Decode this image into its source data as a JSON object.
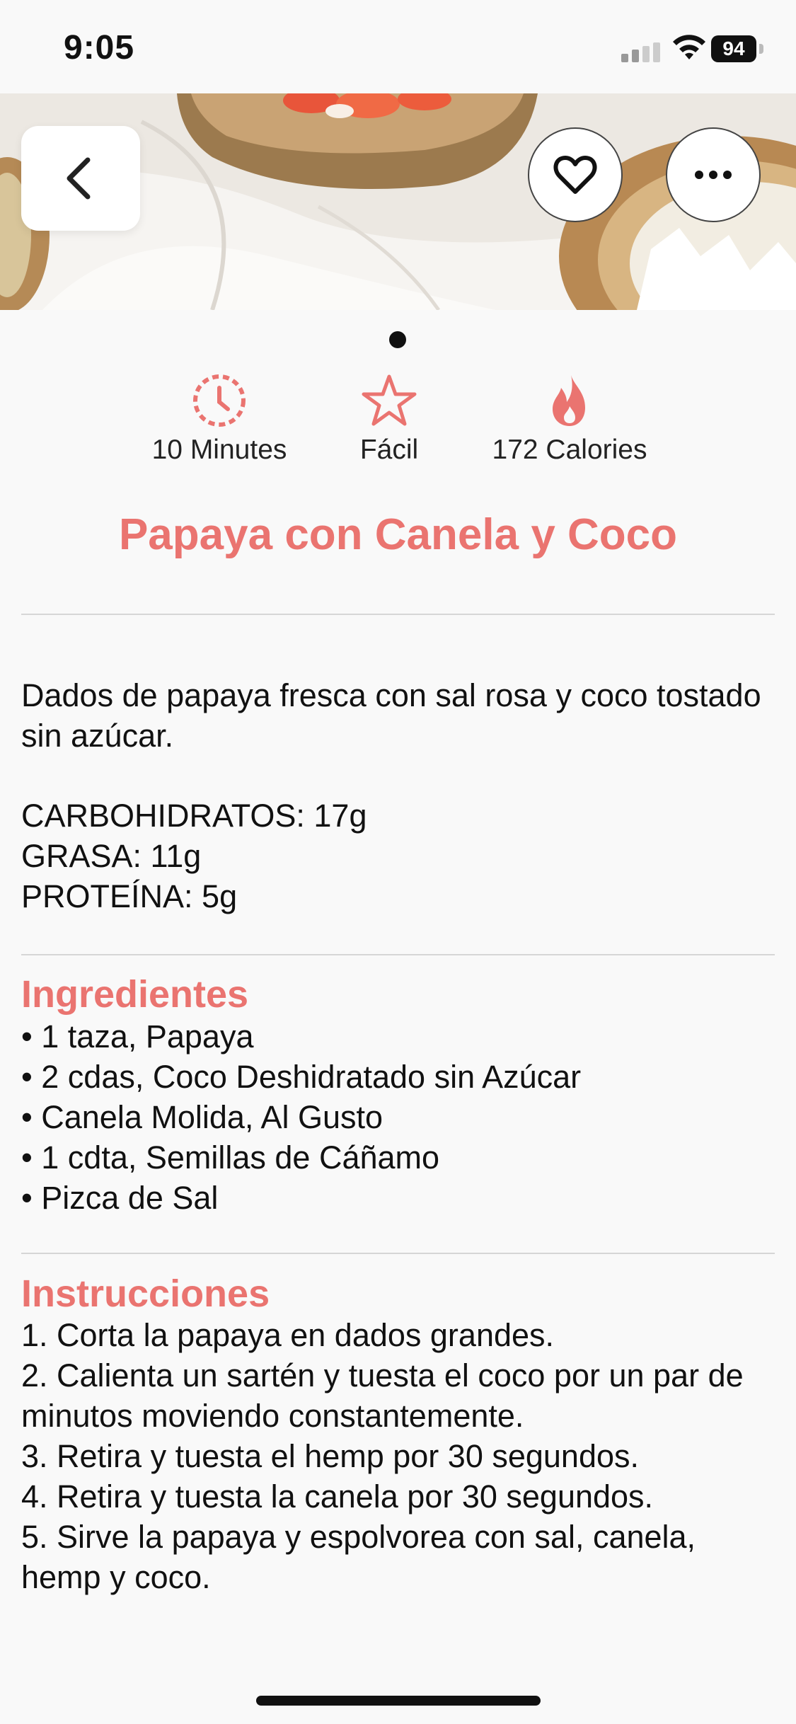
{
  "status_bar": {
    "time": "9:05",
    "battery": "94",
    "signal_icon": "cellular-signal-icon",
    "wifi_icon": "wifi-icon"
  },
  "hero": {
    "image_alt": "papaya-coconut-bowls-photo",
    "back_icon": "chevron-left-icon",
    "favorite_icon": "heart-icon",
    "more_icon": "ellipsis-icon",
    "page_indicator": {
      "current": 1,
      "total": 1
    }
  },
  "stats": {
    "time": {
      "label": "10 Minutes",
      "icon": "clock-icon"
    },
    "difficulty": {
      "label": "Fácil",
      "icon": "star-icon"
    },
    "calories": {
      "label": "172 Calories",
      "icon": "flame-icon"
    }
  },
  "recipe": {
    "title": "Papaya con Canela y Coco",
    "description": "Dados de papaya fresca con sal rosa y coco tostado sin azúcar.",
    "macros": [
      "CARBOHIDRATOS: 17g",
      "GRASA: 11g",
      "PROTEÍNA: 5g"
    ]
  },
  "ingredients": {
    "title": "Ingredientes",
    "items": [
      "• 1 taza, Papaya",
      "• 2 cdas, Coco Deshidratado sin Azúcar",
      "• Canela Molida, Al Gusto",
      "• 1 cdta, Semillas de Cáñamo",
      "• Pizca de Sal"
    ]
  },
  "instructions": {
    "title": "Instrucciones",
    "steps": [
      "1. Corta la papaya en dados grandes.",
      "2. Calienta un sartén y tuesta el coco por un par de minutos moviendo constantemente.",
      "3. Retira y tuesta el hemp por 30 segundos.",
      "4. Retira y tuesta la canela por 30 segundos.",
      "5. Sirve la papaya y espolvorea con sal, canela, hemp y coco."
    ]
  },
  "colors": {
    "accent": "#ea7470",
    "background": "#f9f9f9",
    "text": "#111111"
  }
}
